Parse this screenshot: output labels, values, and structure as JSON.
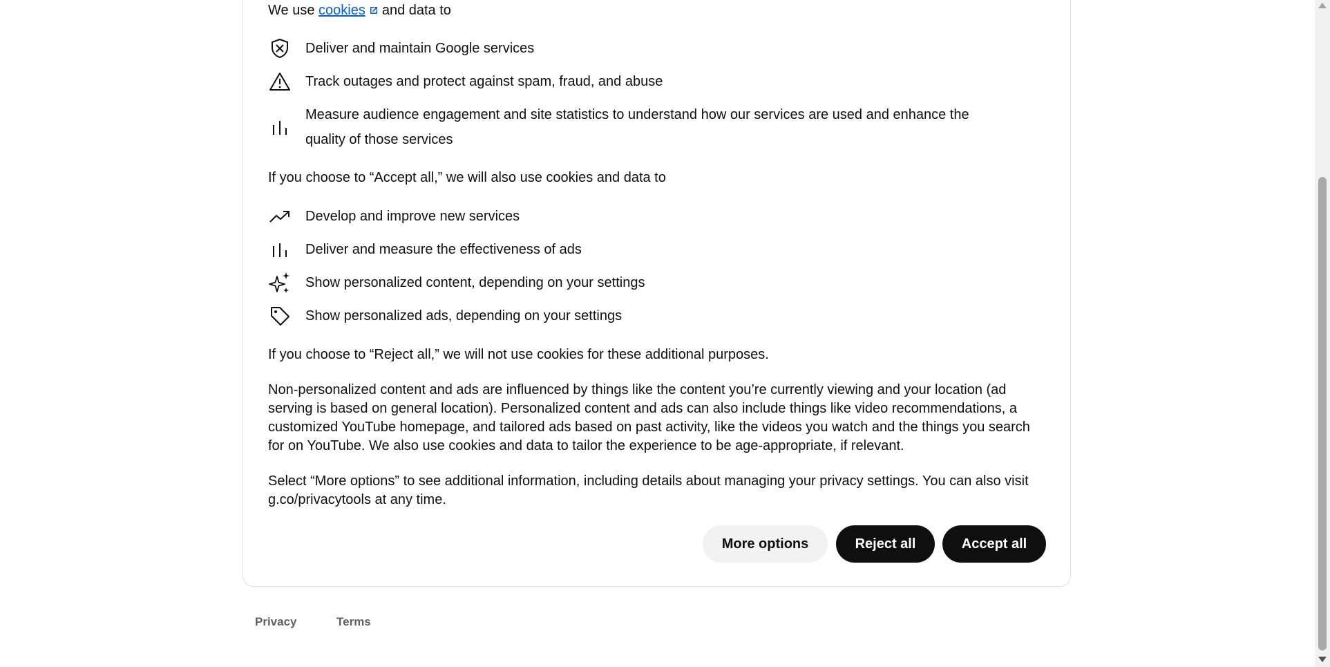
{
  "intro": {
    "prefix": "We use",
    "link_label": "cookies",
    "suffix": "and data to"
  },
  "essential_items": [
    {
      "icon": "shield-icon",
      "text": "Deliver and maintain Google services"
    },
    {
      "icon": "warning-icon",
      "text": "Track outages and protect against spam, fraud, and abuse"
    },
    {
      "icon": "bar-chart-icon",
      "text_line1": "Measure audience engagement and site statistics to understand how our services are used and enhance the",
      "text_line2": "quality of those services"
    }
  ],
  "accept_heading": "If you choose to “Accept all,” we will also use cookies and data to",
  "optional_items": [
    {
      "icon": "trending-up-icon",
      "text": "Develop and improve new services"
    },
    {
      "icon": "bar-chart-icon",
      "text": "Deliver and measure the effectiveness of ads"
    },
    {
      "icon": "sparkle-icon",
      "text": "Show personalized content, depending on your settings"
    },
    {
      "icon": "tag-icon",
      "text": "Show personalized ads, depending on your settings"
    }
  ],
  "reject_text": "If you choose to “Reject all,” we will not use cookies for these additional purposes.",
  "non_personalized_text": "Non-personalized content and ads are influenced by things like the content you’re currently viewing and your location (ad serving is based on general location). Personalized content and ads can also include things like video recommendations, a customized YouTube homepage, and tailored ads based on past activity, like the videos you watch and the things you search for on YouTube. We also use cookies and data to tailor the experience to be age-appropriate, if relevant.",
  "more_options_text": "Select “More options” to see additional information, including details about managing your privacy settings. You can also visit g.co/privacytools at any time.",
  "buttons": {
    "more_options": "More options",
    "reject_all": "Reject all",
    "accept_all": "Accept all"
  },
  "footer": {
    "privacy": "Privacy",
    "terms": "Terms"
  },
  "colors": {
    "link": "#065fd4",
    "primary_button": "#0f0f0f",
    "secondary_button": "#f2f2f2"
  }
}
